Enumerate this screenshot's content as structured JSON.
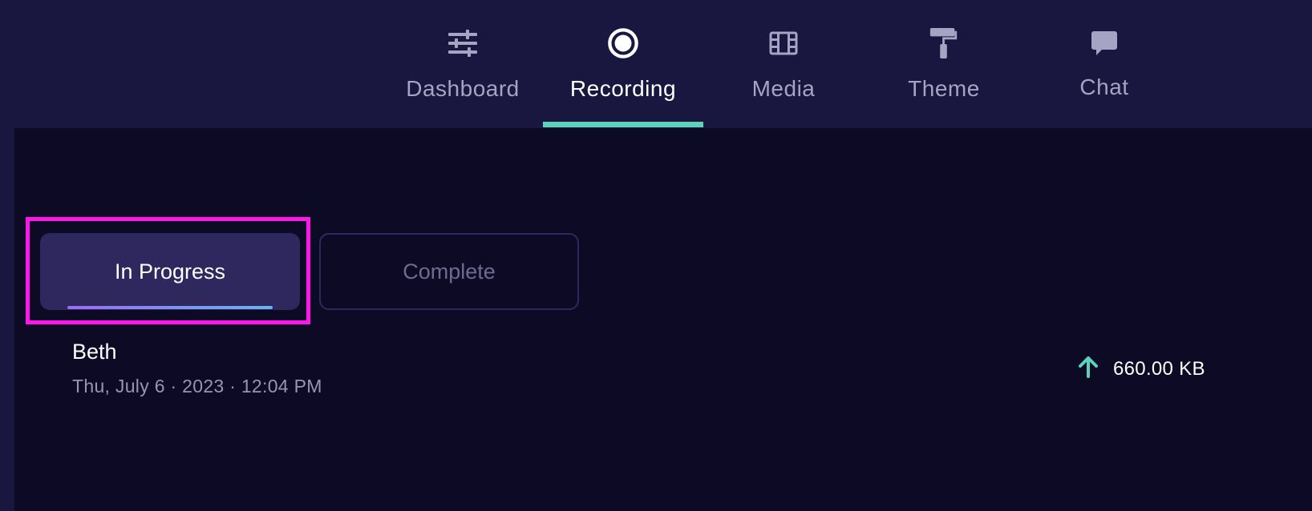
{
  "nav": {
    "tabs": [
      {
        "label": "Dashboard",
        "icon": "sliders-icon",
        "active": false
      },
      {
        "label": "Recording",
        "icon": "record-icon",
        "active": true
      },
      {
        "label": "Media",
        "icon": "film-icon",
        "active": false
      },
      {
        "label": "Theme",
        "icon": "paint-roller-icon",
        "active": false
      },
      {
        "label": "Chat",
        "icon": "chat-bubble-icon",
        "active": false
      }
    ],
    "accent_color": "#5cd2bd"
  },
  "filters": {
    "in_progress_label": "In Progress",
    "complete_label": "Complete",
    "selected": "In Progress"
  },
  "recordings": [
    {
      "name": "Beth",
      "date": "Thu, July 6 · 2023 · 12:04 PM",
      "size": "660.00 KB",
      "status_icon": "arrow-up-icon"
    }
  ],
  "colors": {
    "background": "#0c0a24",
    "header": "#19163f",
    "highlight": "#ff16e8",
    "upload_arrow": "#5cd2bd"
  }
}
